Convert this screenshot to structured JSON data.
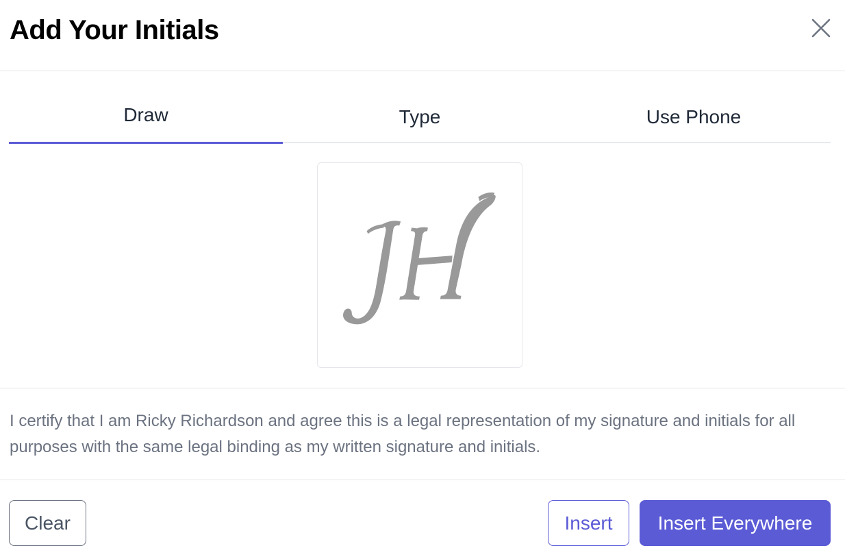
{
  "dialog": {
    "title": "Add Your Initials"
  },
  "icons": {
    "close": "close-icon"
  },
  "tabs": [
    {
      "label": "Draw",
      "active": true
    },
    {
      "label": "Type",
      "active": false
    },
    {
      "label": "Use Phone",
      "active": false
    }
  ],
  "canvas": {
    "drawn_initials": "JH",
    "stroke_color": "#999999"
  },
  "certification": {
    "text": "I certify that I am Ricky Richardson and agree this is a legal representation of my signature and initials for all purposes with the same legal binding as my written signature and initials."
  },
  "footer": {
    "clear_label": "Clear",
    "insert_label": "Insert",
    "insert_everywhere_label": "Insert Everywhere"
  },
  "colors": {
    "accent": "#5b5bd6",
    "muted_text": "#6b7280",
    "border": "#e5e7eb"
  }
}
